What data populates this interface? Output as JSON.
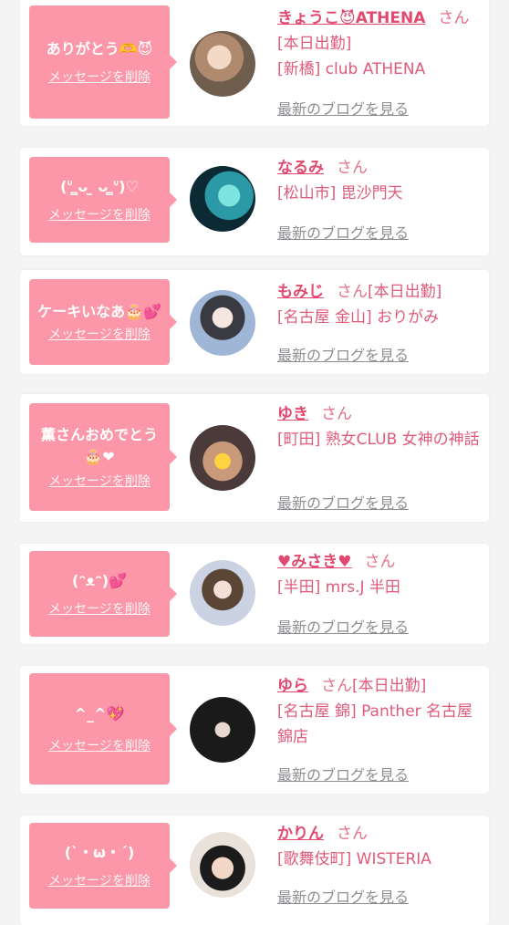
{
  "colors": {
    "bubble": "#fb97a8",
    "name": "#e2496f",
    "link_gray": "#8e8e93"
  },
  "delete_label": "メッセージを削除",
  "blog_label": "最新のブログを見る",
  "items": [
    {
      "message": "ありがとう🫶😈",
      "name": "きょうこ😈ATHENA",
      "san": "さん",
      "status": "[本日出勤]",
      "shop": "[新橋] club ATHENA"
    },
    {
      "message": "(ᐡ ̳ᴗ ̫ ᴗ ̳ᐡ)♡",
      "name": "なるみ",
      "san": "さん",
      "status": "",
      "shop": "[松山市] 毘沙門天"
    },
    {
      "message": "ケーキいなあ🎂💕",
      "name": "もみじ",
      "san": "さん",
      "status": "[本日出勤]",
      "shop": "[名古屋 金山] おりがみ"
    },
    {
      "message": "薫さんおめでとう🎂❤",
      "name": "ゆき",
      "san": "さん",
      "status": "",
      "shop": "[町田] 熟女CLUB 女神の神話"
    },
    {
      "message": "(ᵔᴥᵔ)💕",
      "name": "♥みさき♥",
      "san": "さん",
      "status": "",
      "shop": "[半田] mrs.J 半田"
    },
    {
      "message": "^_^💖",
      "name": "ゆら",
      "san": "さん",
      "status": "[本日出勤]",
      "shop": "[名古屋 錦] Panther 名古屋錦店"
    },
    {
      "message": "(ˋ・ω・ˊ)",
      "name": "かりん",
      "san": "さん",
      "status": "",
      "shop": "[歌舞伎町] WISTERIA"
    }
  ]
}
